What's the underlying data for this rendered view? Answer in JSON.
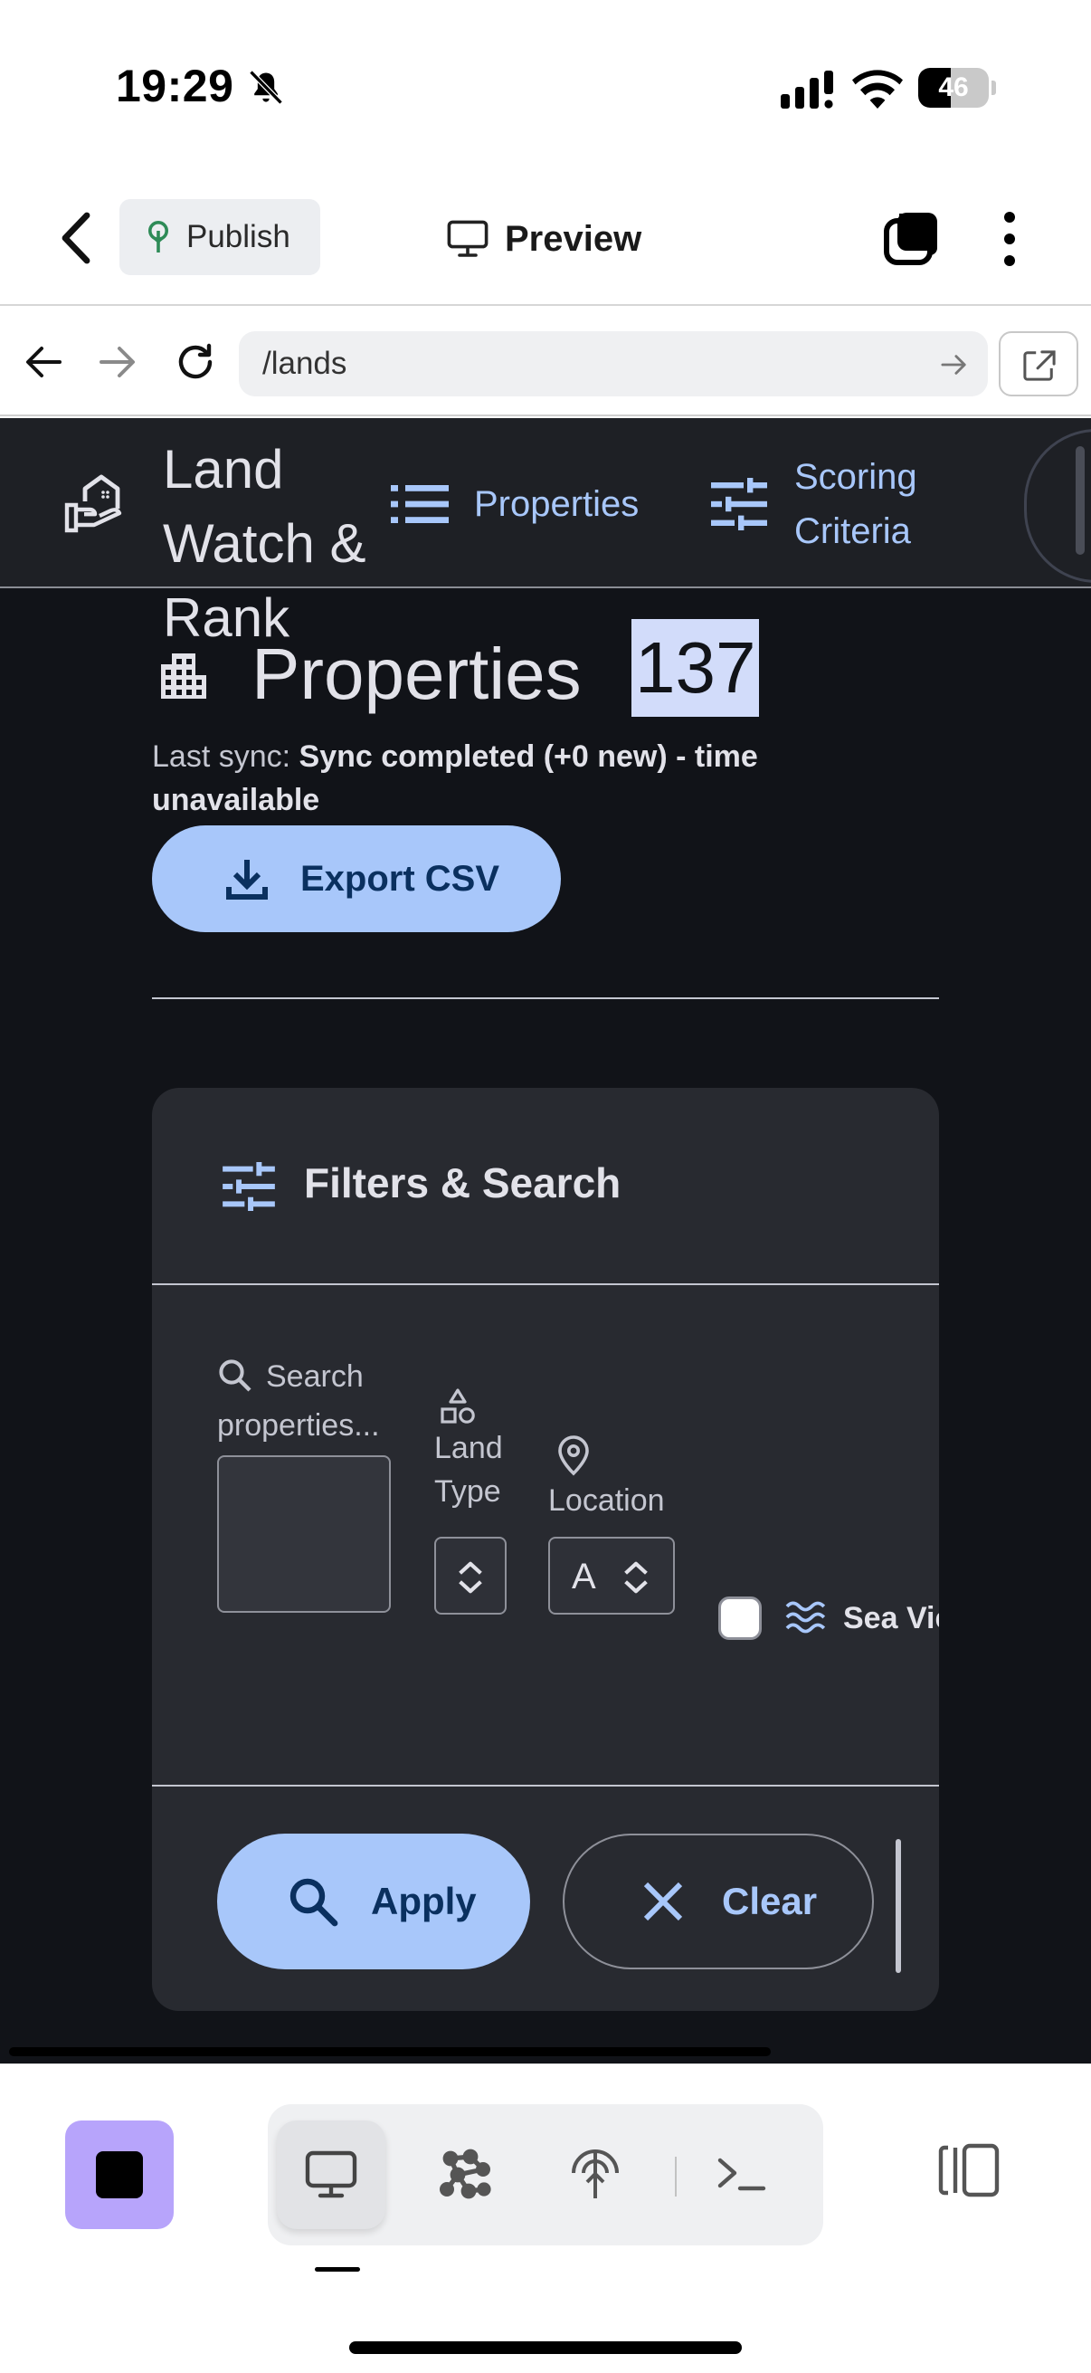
{
  "status_bar": {
    "time": "19:29",
    "battery": "46",
    "battery_level": 0.46,
    "icons": [
      "bell-slash-icon",
      "cellular-signal-icon",
      "wifi-icon",
      "battery-icon"
    ]
  },
  "toolbar": {
    "publish_label": "Publish",
    "preview_label": "Preview",
    "icons": [
      "chevron-left-icon",
      "tree-icon",
      "monitor-icon",
      "tabs-icon",
      "more-vertical-icon"
    ]
  },
  "browser": {
    "url": "/lands",
    "icons": [
      "arrow-left-icon",
      "arrow-right-icon",
      "reload-icon",
      "go-arrow-icon",
      "open-external-icon"
    ]
  },
  "app": {
    "brand": "Land Watch & Rank",
    "nav": {
      "properties": "Properties",
      "scoring_criteria": "Scoring Criteria"
    },
    "page": {
      "title": "Properties",
      "count": "137",
      "sync_prefix": "Last sync: ",
      "sync_value": "Sync completed (+0 new) - time unavailable",
      "export_label": "Export CSV"
    },
    "filters": {
      "title": "Filters & Search",
      "search_placeholder": "Search properties...",
      "land_type_label": "Land Type",
      "location_label": "Location",
      "location_value": "A",
      "sea_view_label": "Sea View",
      "sea_view_checked": false,
      "apply_label": "Apply",
      "clear_label": "Clear"
    }
  },
  "colors": {
    "primary": "#a8c7fa",
    "on_primary": "#0a305f",
    "surface": "#111318",
    "card": "#282a30",
    "dock_accent": "#b7a4fb"
  },
  "dock": {
    "icons": [
      "stop-icon",
      "monitor-icon",
      "graph-icon",
      "antenna-icon",
      "terminal-icon",
      "panels-icon"
    ]
  }
}
